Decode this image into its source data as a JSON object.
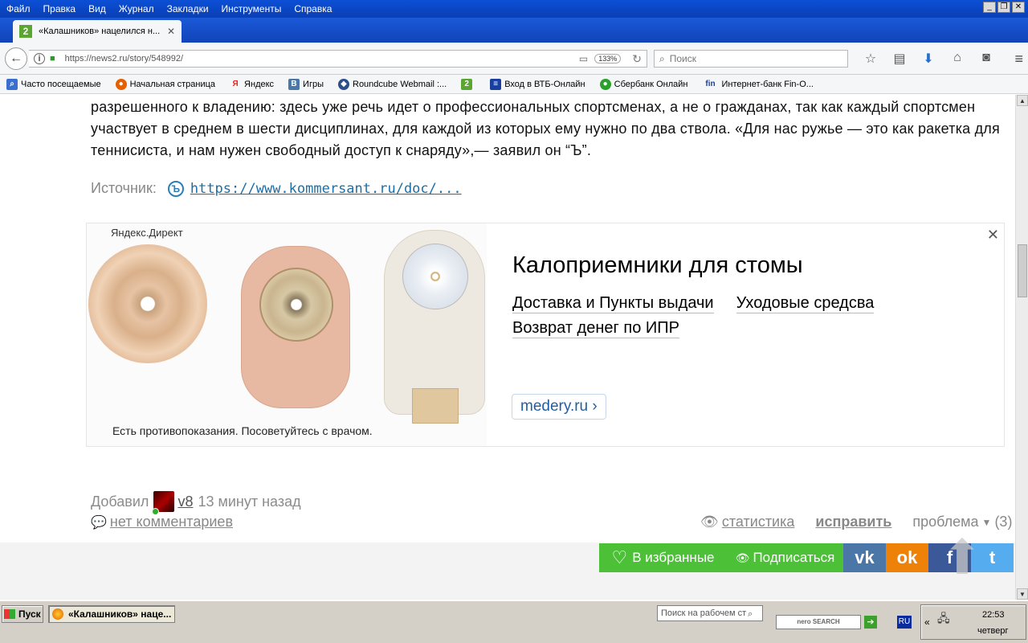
{
  "menu": [
    "Файл",
    "Правка",
    "Вид",
    "Журнал",
    "Закладки",
    "Инструменты",
    "Справка"
  ],
  "window_buttons": [
    "_",
    "❐",
    "✕"
  ],
  "tab": {
    "title": "«Калашников» нацелился н...",
    "favicon": "2"
  },
  "nav": {
    "url": "https://news2.ru/story/548992/",
    "zoom": "133%",
    "search_placeholder": "Поиск"
  },
  "bookmarks": [
    {
      "label": "Часто посещаемые",
      "icon": "search-icon",
      "color": "#3a6fd0",
      "glyph": "⌕"
    },
    {
      "label": "Начальная страница",
      "icon": "firefox-icon",
      "color": "#e66000",
      "glyph": "●"
    },
    {
      "label": "Яндекс",
      "icon": "yandex-icon",
      "color": "#ffffff",
      "glyph": "Я"
    },
    {
      "label": "Игры",
      "icon": "vk-icon",
      "color": "#4a76a8",
      "glyph": "B"
    },
    {
      "label": "Roundcube Webmail :...",
      "icon": "roundcube-icon",
      "color": "#2b4f8a",
      "glyph": "◆"
    },
    {
      "label": "",
      "icon": "news2-icon",
      "color": "#5aa630",
      "glyph": "2"
    },
    {
      "label": "Вход в ВТБ-Онлайн",
      "icon": "vtb-icon",
      "color": "#1a3f9c",
      "glyph": "≡"
    },
    {
      "label": "Сбербанк Онлайн",
      "icon": "sberbank-icon",
      "color": "#2ca02c",
      "glyph": "●"
    },
    {
      "label": "Интернет-банк Fin-O...",
      "icon": "fin-icon",
      "color": "#1a3f9c",
      "glyph": "fin"
    }
  ],
  "article": {
    "text": "разрешенного к владению: здесь уже речь идет о профессиональных спортсменах, а не о гражданах, так как каждый спортсмен участвует в среднем в шести дисциплинах, для каждой из которых ему нужно по два ствола. «Для нас ружье — это как ракетка для теннисиста, и нам нужен свободный доступ к снаряду»,— заявил он “Ъ”.",
    "source_label": "Источник:",
    "source_icon": "Ъ",
    "source_link": "https://www.kommersant.ru/doc/..."
  },
  "ad": {
    "label": "Яндекс.Директ",
    "title": "Калоприемники для стомы",
    "links": [
      "Доставка и Пункты выдачи",
      "Уходовые средсва",
      "Возврат денег по ИПР"
    ],
    "domain": "medery.ru ›",
    "disclaimer": "Есть противопоказания. Посоветуйтесь с врачом.",
    "close": "✕"
  },
  "meta": {
    "added_label": "Добавил",
    "user": "v8",
    "time": "13 минут назад",
    "comments": "нет комментариев",
    "stats": "статистика",
    "fix": "исправить",
    "problem": "проблема",
    "problem_count": "(3)"
  },
  "share": {
    "favorite": "В избранные",
    "subscribe": "Подписаться",
    "vk": "vk",
    "ok": "ok",
    "fb": "f",
    "tw": "t"
  },
  "taskbar": {
    "start": "Пуск",
    "task": "«Калашников» наце...",
    "desktop_search": "Поиск на рабочем ст",
    "nero": "nero SEARCH",
    "lang": "RU",
    "time": "22:53",
    "day": "четверг"
  }
}
